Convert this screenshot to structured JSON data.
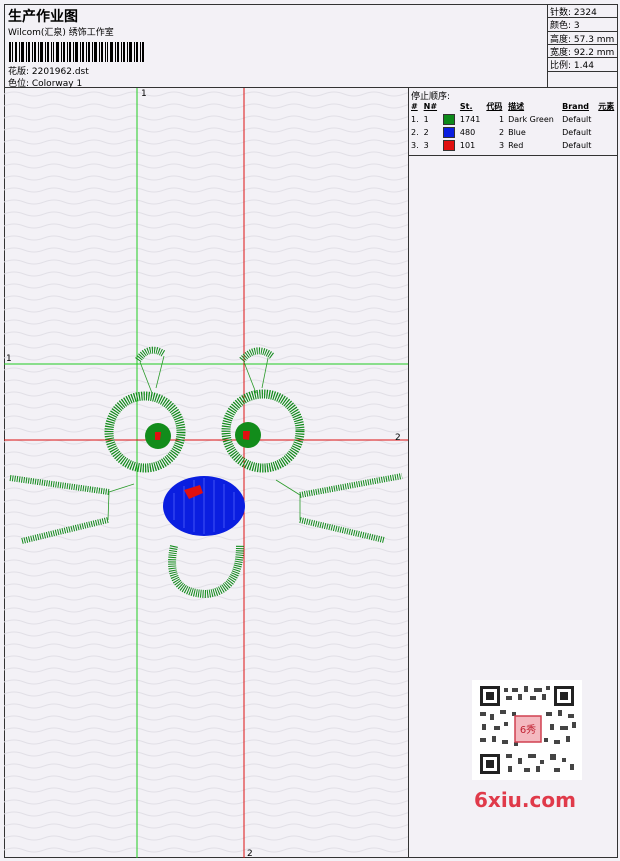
{
  "header": {
    "title": "生产作业图",
    "company": "Wilcom(汇泉) 绣饰工作室",
    "design_file": "花版: 2201962.dst",
    "colorway": "色位: Colorway 1"
  },
  "stats": {
    "stitches": "针数: 2324",
    "colors": "颜色: 3",
    "height": "高度: 57.3 mm",
    "width": "宽度: 92.2 mm",
    "scale": "比例: 1.44"
  },
  "sequence": {
    "title": "停止顺序:",
    "headers": [
      "#",
      "N#",
      "St.",
      "代码",
      "描述",
      "Brand",
      "元素"
    ],
    "rows": [
      {
        "idx": "1.",
        "num": "1",
        "color": "#0d8a1a",
        "stitches": "1741",
        "code": "1",
        "desc": "Dark Green",
        "brand": "Default"
      },
      {
        "idx": "2.",
        "num": "2",
        "color": "#0a1ee0",
        "stitches": "480",
        "code": "2",
        "desc": "Blue",
        "brand": "Default"
      },
      {
        "idx": "3.",
        "num": "3",
        "color": "#e01010",
        "stitches": "101",
        "code": "3",
        "desc": "Red",
        "brand": "Default"
      }
    ]
  },
  "guides": {
    "green_label_top": "1",
    "green_label_left": "1",
    "red_label_right": "2",
    "red_label_bottom": "2",
    "green_color": "#22cc22",
    "red_color": "#dd1111"
  },
  "watermark": {
    "text": "6xiu.com",
    "seal_text": "6秀"
  }
}
